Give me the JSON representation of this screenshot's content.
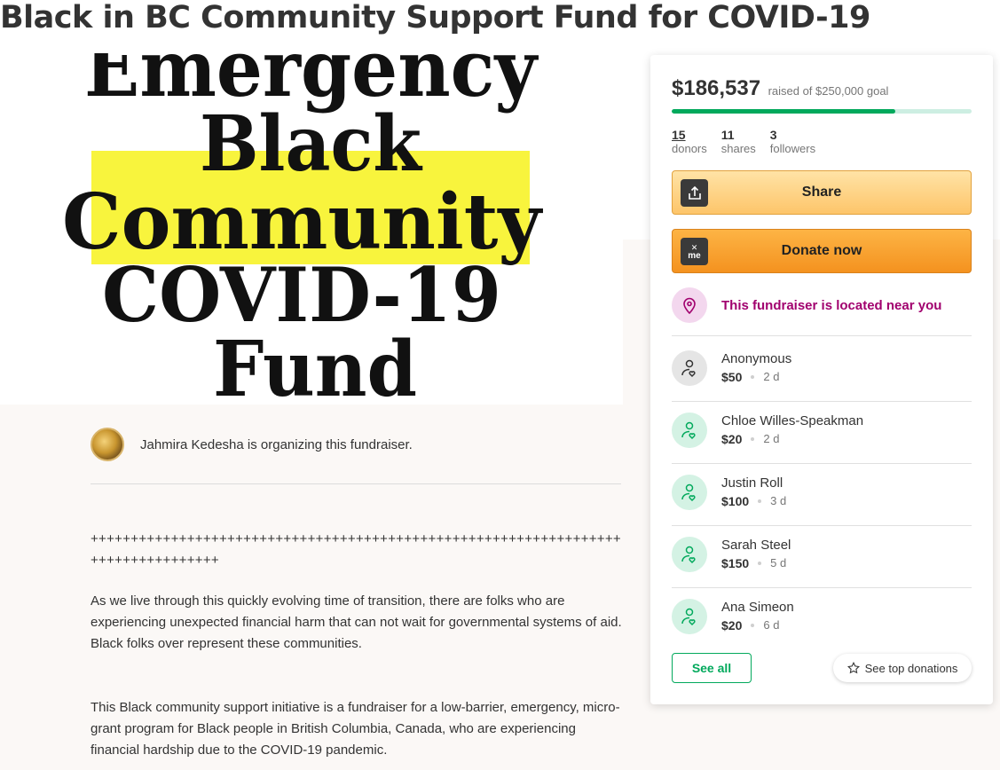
{
  "title": "Black in BC Community Support Fund for COVID-19",
  "hero": {
    "lines": [
      "Emergency",
      "Black",
      "Community",
      "COVID-19",
      "Fund"
    ]
  },
  "organizer": {
    "text": "Jahmira Kedesha is organizing this fundraiser."
  },
  "story": {
    "pluses": "++++++++++++++++++++++++++++++++++++++++++++++++++++++++++++++++++++++++++++++++++",
    "paragraph1": "As we live through this quickly evolving time of transition, there are folks who are experiencing unexpected financial harm that can not wait for governmental systems of aid. Black folks over represent these communities.",
    "paragraph2": "This Black community support initiative is a fundraiser for a low-barrier, emergency, micro-grant program for Black people in British Columbia, Canada, who are experiencing financial hardship due to the COVID-19 pandemic."
  },
  "sidebar": {
    "raised_amount": "$186,537",
    "goal_text": "raised of $250,000 goal",
    "progress_fraction": 0.746,
    "stats": [
      {
        "num": "15",
        "label": "donors"
      },
      {
        "num": "11",
        "label": "shares"
      },
      {
        "num": "3",
        "label": "followers"
      }
    ],
    "share_label": "Share",
    "donate_label": "Donate now",
    "donate_icon_text": "me",
    "near_text": "This fundraiser is located near you",
    "donations": [
      {
        "name": "Anonymous",
        "amount": "$50",
        "time": "2 d"
      },
      {
        "name": "Chloe Willes-Speakman",
        "amount": "$20",
        "time": "2 d"
      },
      {
        "name": "Justin Roll",
        "amount": "$100",
        "time": "3 d"
      },
      {
        "name": "Sarah Steel",
        "amount": "$150",
        "time": "5 d"
      },
      {
        "name": "Ana Simeon",
        "amount": "$20",
        "time": "6 d"
      }
    ],
    "see_all_label": "See all",
    "see_top_label": "See top donations"
  },
  "colors": {
    "accent_green": "#02a95c",
    "near_magenta": "#a1006e",
    "highlight_yellow": "#f8f43d"
  }
}
